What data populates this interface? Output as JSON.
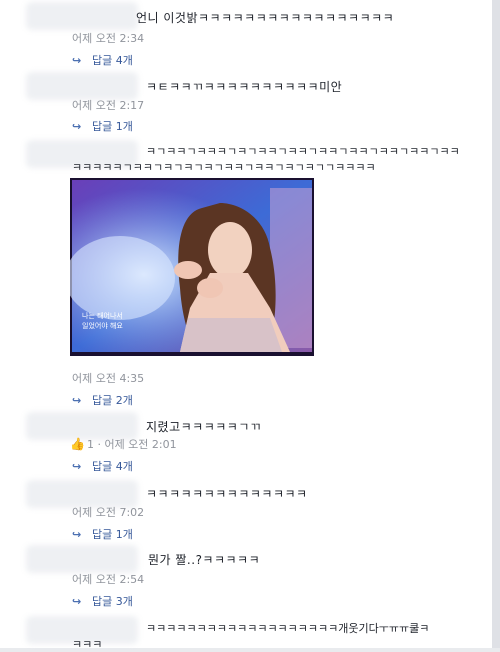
{
  "comments": [
    {
      "text": "언니 이것밝ㅋㅋㅋㅋㅋㅋㅋㅋㅋㅋㅋㅋㅋㅋㅋㅋㅋ",
      "time": "어제 오전 2:34",
      "reply": "답글 4개"
    },
    {
      "text": "ㅋㅌㅋㅋㄲㅋㅋㅋㅋㅋㅋㅋㅋㅋㅋ미안",
      "time": "어제 오전 2:17",
      "reply": "답글 1개"
    },
    {
      "text_line1": "ㅋㄱㅋㅋㄱㅋㅋㅋㄱㅋㄱㅋㅋㄱㅋㅋㄱㅋㅋㄱㅋㅋㄱㅋㅋㄱㅋㅋㄱㅋㅋ",
      "text_line2": "ㅋㅋㅋㅋㅋㄱㅋㅋㄱㅋㄱㅋㄱㅋㄱㅋㅋㄱㅋㅋㄱㅋㄱㅋㄱㄱㅋㅋㅋㅋ",
      "time": "어제 오전 4:35",
      "reply": "답글 2개",
      "photo_caption_line1": "나는 태어나서",
      "photo_caption_line2": "일었어야 해요"
    },
    {
      "text": "지렸고ㅋㅋㅋㅋㅋㄱㄲ",
      "likes": "1",
      "time": "· 어제 오전 2:01",
      "reply": "답글 4개"
    },
    {
      "text": "ㅋㅋㅋㅋㅋㅋㅋㅋㅋㅋㅋㅋㅋㅋ",
      "time": "어제 오전 7:02",
      "reply": "답글 1개"
    },
    {
      "text": "뭔가 짤..?ㅋㅋㅋㅋㅋ",
      "time": "어제 오전 2:54",
      "reply": "답글 3개"
    },
    {
      "text_line1": "ㅋㅋㅋㅋㅋㅋㅋㅋㅋㅋㅋㅋㅋㅋㅋㅋㅋㅋㅋ개웃기다ㅜㅠㅠ쿨ㅋ",
      "text_line2": "ㅋㅋㅋ"
    }
  ],
  "icons": {
    "reply_arrow": "reply-arrow-icon",
    "like": "thumbs-up-icon"
  },
  "colors": {
    "link": "#365899",
    "meta": "#90949c",
    "like": "#4267b2"
  }
}
